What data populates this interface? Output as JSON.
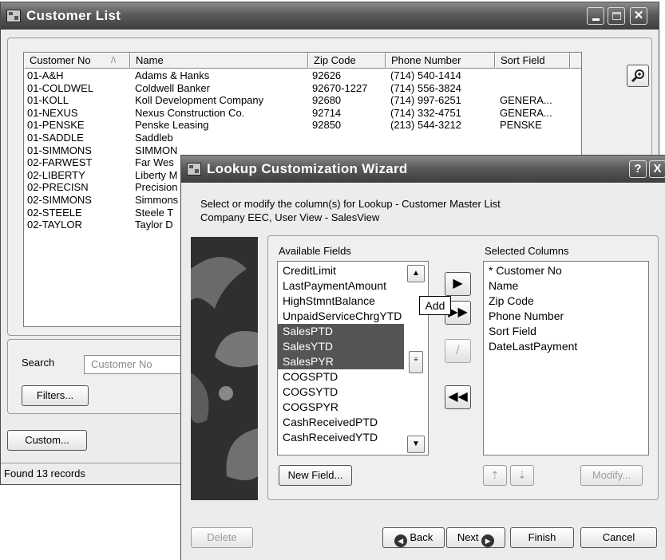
{
  "customer_window": {
    "title": "Customer List",
    "columns": [
      "Customer No",
      "Name",
      "Zip Code",
      "Phone Number",
      "Sort Field"
    ],
    "sort_indicator": "/\\",
    "rows": [
      {
        "no": "01-A&H",
        "name": "Adams & Hanks",
        "zip": "92626",
        "phone": "(714) 540-1414",
        "sort": ""
      },
      {
        "no": "01-COLDWEL",
        "name": "Coldwell Banker",
        "zip": "92670-1227",
        "phone": "(714) 556-3824",
        "sort": ""
      },
      {
        "no": "01-KOLL",
        "name": "Koll Development Company",
        "zip": "92680",
        "phone": "(714) 997-6251",
        "sort": "GENERA..."
      },
      {
        "no": "01-NEXUS",
        "name": "Nexus Construction Co.",
        "zip": "92714",
        "phone": "(714) 332-4751",
        "sort": "GENERA..."
      },
      {
        "no": "01-PENSKE",
        "name": "Penske Leasing",
        "zip": "92850",
        "phone": "(213) 544-3212",
        "sort": "PENSKE"
      },
      {
        "no": "01-SADDLE",
        "name": "Saddleb",
        "zip": "",
        "phone": "",
        "sort": ""
      },
      {
        "no": "01-SIMMONS",
        "name": "SIMMON",
        "zip": "",
        "phone": "",
        "sort": ""
      },
      {
        "no": "02-FARWEST",
        "name": "Far Wes",
        "zip": "",
        "phone": "",
        "sort": ""
      },
      {
        "no": "02-LIBERTY",
        "name": "Liberty M",
        "zip": "",
        "phone": "",
        "sort": ""
      },
      {
        "no": "02-PRECISN",
        "name": "Precision",
        "zip": "",
        "phone": "",
        "sort": ""
      },
      {
        "no": "02-SIMMONS",
        "name": "Simmons",
        "zip": "",
        "phone": "",
        "sort": ""
      },
      {
        "no": "02-STEELE",
        "name": "Steele T",
        "zip": "",
        "phone": "",
        "sort": ""
      },
      {
        "no": "02-TAYLOR",
        "name": "Taylor D",
        "zip": "",
        "phone": "",
        "sort": ""
      }
    ],
    "search_label": "Search",
    "search_value": "Customer No",
    "filters_button": "Filters...",
    "custom_button": "Custom...",
    "status_text": "Found 13 records"
  },
  "wizard": {
    "title": "Lookup Customization Wizard",
    "help_button": "?",
    "close_button": "X",
    "description_line1": "Select or modify the column(s) for Lookup - Customer Master List",
    "description_line2": "Company EEC, User  View - SalesView",
    "available_label": "Available Fields",
    "available_fields": [
      {
        "label": "CreditLimit",
        "selected": false
      },
      {
        "label": "LastPaymentAmount",
        "selected": false
      },
      {
        "label": "HighStmntBalance",
        "selected": false
      },
      {
        "label": "UnpaidServiceChrgYTD",
        "selected": false
      },
      {
        "label": "SalesPTD",
        "selected": true
      },
      {
        "label": "SalesYTD",
        "selected": true
      },
      {
        "label": "SalesPYR",
        "selected": true
      },
      {
        "label": "COGSPTD",
        "selected": false
      },
      {
        "label": "COGSYTD",
        "selected": false
      },
      {
        "label": "COGSPYR",
        "selected": false
      },
      {
        "label": "CashReceivedPTD",
        "selected": false
      },
      {
        "label": "CashReceivedYTD",
        "selected": false
      }
    ],
    "selected_label": "Selected Columns",
    "selected_columns": [
      "* Customer No",
      "Name",
      "Zip Code",
      "Phone Number",
      "Sort Field",
      "DateLastPayment"
    ],
    "tooltip": "Add",
    "new_field_button": "New Field...",
    "modify_button": "Modify...",
    "delete_button": "Delete",
    "back_button": "Back",
    "next_button": "Next",
    "finish_button": "Finish",
    "cancel_button": "Cancel"
  }
}
